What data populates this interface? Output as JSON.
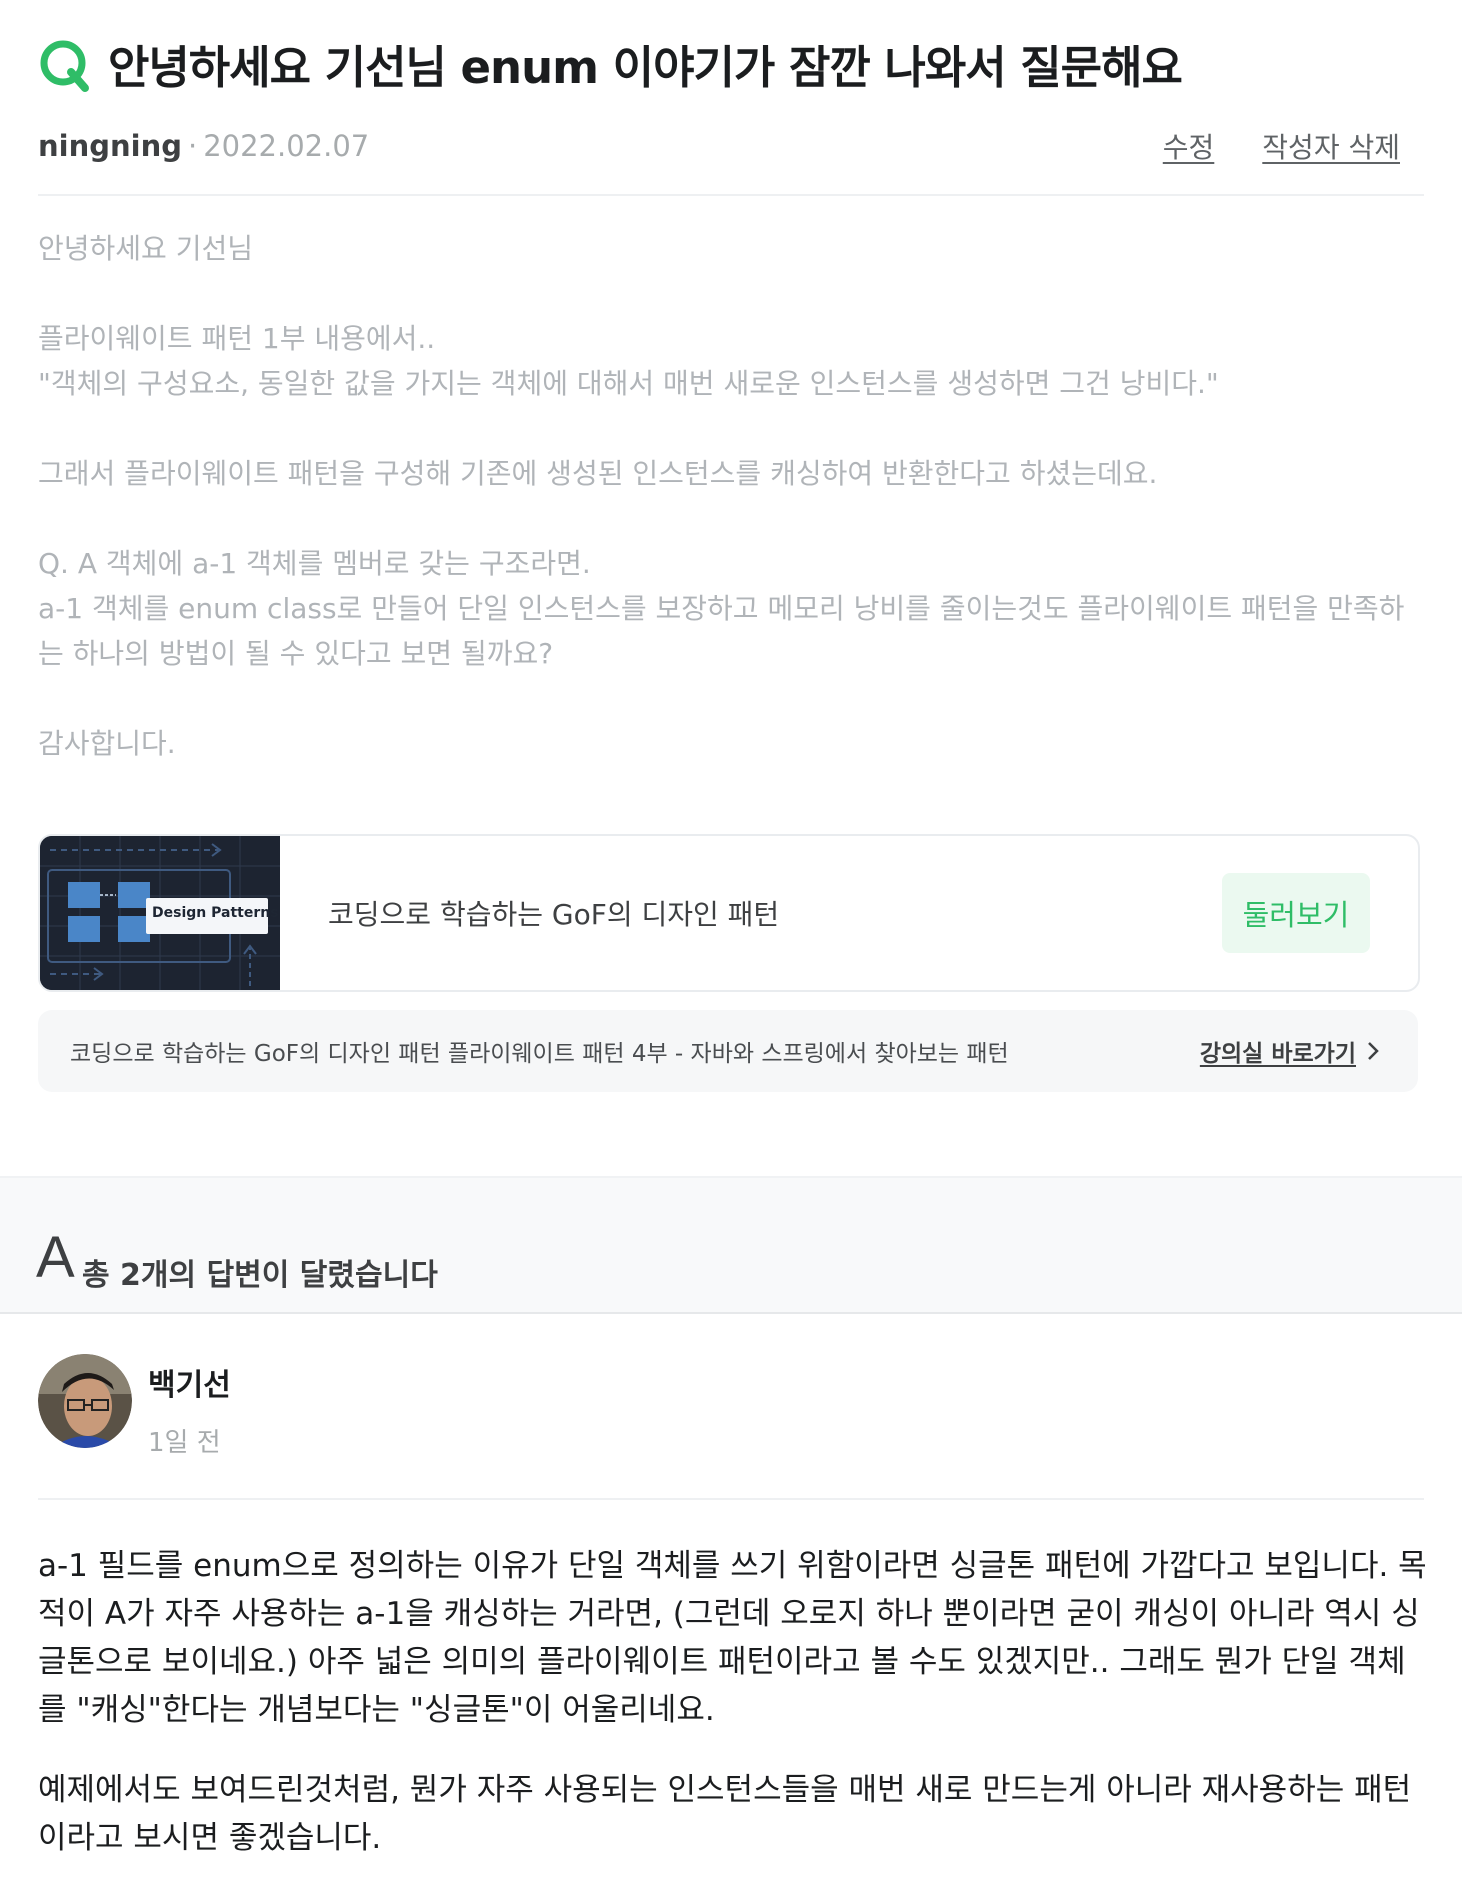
{
  "question": {
    "badge": "Q",
    "title": "안녕하세요 기선님 enum 이야기가 잠깐 나와서 질문해요",
    "author": "ningning",
    "separator": "·",
    "date": "2022.02.07",
    "edit_label": "수정",
    "delete_label": "작성자 삭제",
    "body": [
      "안녕하세요 기선님",
      "",
      "플라이웨이트 패턴 1부 내용에서..",
      "\"객체의 구성요소, 동일한 값을 가지는 객체에 대해서 매번 새로운 인스턴스를 생성하면 그건 낭비다.\"",
      "",
      "그래서 플라이웨이트 패턴을 구성해 기존에 생성된 인스턴스를 캐싱하여 반환한다고 하셨는데요.",
      "",
      "Q. A 객체에 a-1 객체를 멤버로 갖는 구조라면.",
      "a-1 객체를 enum class로 만들어 단일 인스턴스를 보장하고 메모리 낭비를 줄이는것도 플라이웨이트 패턴을 만족하는 하나의 방법이 될 수 있다고 보면 될까요?",
      "",
      "감사합니다."
    ]
  },
  "course": {
    "thumb_label": "Design Patterns",
    "name": "코딩으로 학습하는 GoF의 디자인 패턴",
    "browse_label": "둘러보기"
  },
  "unit": {
    "text": "코딩으로 학습하는 GoF의 디자인 패턴 플라이웨이트 패턴 4부 - 자바와 스프링에서 찾아보는 패턴",
    "goto_label": "강의실 바로가기"
  },
  "answers": {
    "letter": "A",
    "count_text": "총 2개의 답변이 달렸습니다",
    "items": [
      {
        "name": "백기선",
        "time": "1일 전",
        "paragraphs": [
          "a-1 필드를 enum으로 정의하는 이유가 단일 객체를 쓰기 위함이라면 싱글톤 패턴에 가깝다고 보입니다. 목적이 A가 자주 사용하는 a-1을 캐싱하는 거라면, (그런데 오로지 하나 뿐이라면 굳이 캐싱이 아니라 역시 싱글톤으로 보이네요.) 아주 넓은 의미의 플라이웨이트 패턴이라고 볼 수도 있겠지만.. 그래도 뭔가 단일 객체를 \"캐싱\"한다는 개념보다는 \"싱글톤\"이 어울리네요.",
          "예제에서도 보여드린것처럼, 뭔가 자주 사용되는 인스턴스들을 매번 새로 만드는게 아니라 재사용하는 패턴이라고 보시면 좋겠습니다."
        ]
      }
    ]
  },
  "colors": {
    "accent": "#2fbd67",
    "accent_bg": "#ebf9f0",
    "muted_text": "#b0b4b8"
  }
}
